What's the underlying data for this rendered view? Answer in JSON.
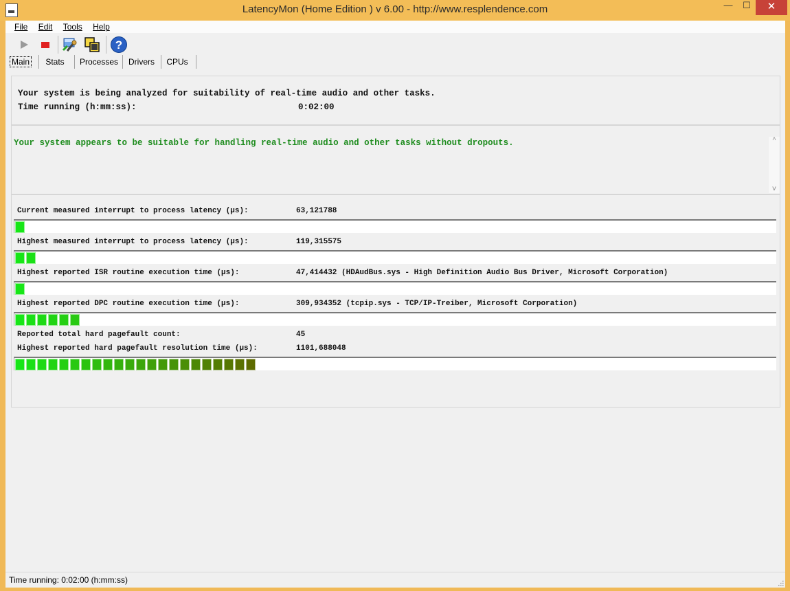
{
  "window": {
    "title": "LatencyMon  (Home Edition )  v 6.00 - http://www.resplendence.com",
    "minimize": "—",
    "maximize": "☐",
    "close": "✕"
  },
  "menu": [
    "File",
    "Edit",
    "Tools",
    "Help"
  ],
  "toolbar": {
    "help_glyph": "?"
  },
  "tabs": [
    "Main",
    "Stats",
    "Processes",
    "Drivers",
    "CPUs"
  ],
  "summary": {
    "analyzing": "Your system is being analyzed for suitability of real-time audio and other tasks.",
    "time_label": "Time running (h:mm:ss):",
    "time_value": "0:02:00"
  },
  "verdict": {
    "message": "Your system appears to be suitable for handling real-time audio and other tasks without dropouts.",
    "scroll_up": "^",
    "scroll_down": "v"
  },
  "measurements": [
    {
      "label": "Current measured interrupt to process latency (µs):",
      "value": "63,121788",
      "meter_segments": 1
    },
    {
      "label": "Highest measured interrupt to process latency (µs):",
      "value": "119,315575",
      "meter_segments": 2
    },
    {
      "label": "Highest reported ISR routine execution time (µs):",
      "value": "47,414432  (HDAudBus.sys - High Definition Audio Bus Driver, Microsoft Corporation)",
      "meter_segments": 1
    },
    {
      "label": "Highest reported DPC routine execution time (µs):",
      "value": "309,934352  (tcpip.sys - TCP/IP-Treiber, Microsoft Corporation)",
      "meter_segments": 6
    },
    {
      "label": "Reported total hard pagefault count:",
      "value": "45",
      "meter_segments": null
    },
    {
      "label": "Highest reported hard pagefault resolution time (µs):",
      "value": "1101,688048",
      "meter_segments": 22
    }
  ],
  "meter_colors": {
    "start": "#17e617",
    "end": "#5e6b00"
  },
  "statusbar": {
    "text": "Time running: 0:02:00  (h:mm:ss)"
  }
}
